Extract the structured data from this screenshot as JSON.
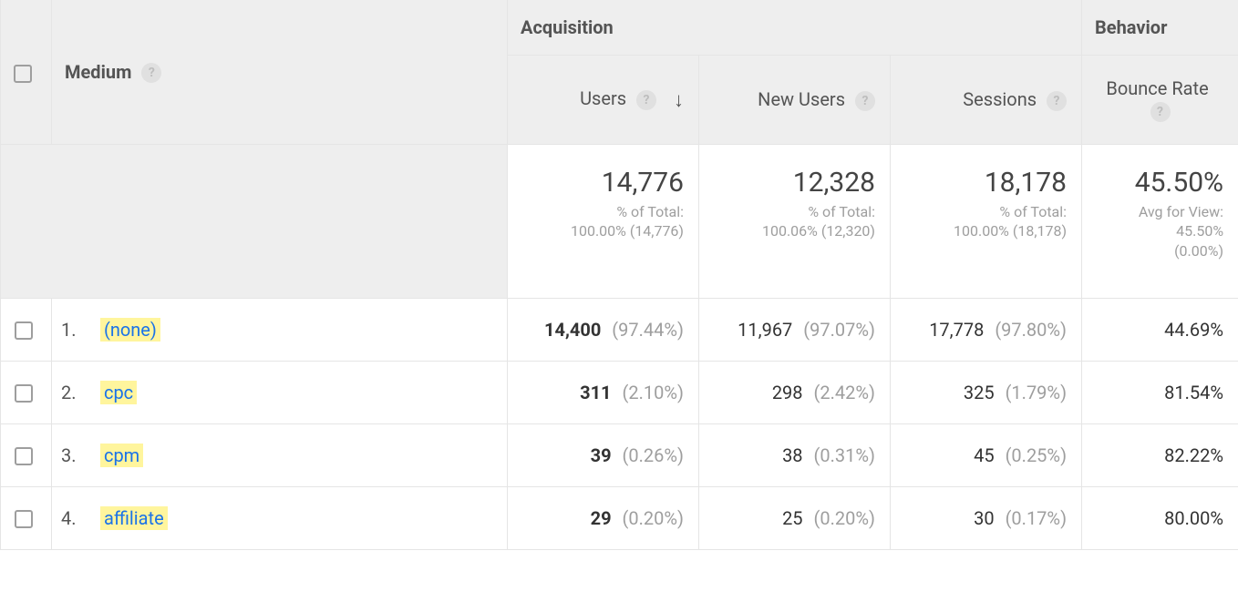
{
  "headers": {
    "dimension": "Medium",
    "group1": "Acquisition",
    "group2": "Behavior",
    "metrics": {
      "users": "Users",
      "new_users": "New Users",
      "sessions": "Sessions",
      "bounce_rate": "Bounce Rate"
    }
  },
  "totals": {
    "users": {
      "value": "14,776",
      "sub1": "% of Total:",
      "sub2": "100.00% (14,776)"
    },
    "new_users": {
      "value": "12,328",
      "sub1": "% of Total:",
      "sub2": "100.06% (12,320)"
    },
    "sessions": {
      "value": "18,178",
      "sub1": "% of Total:",
      "sub2": "100.00% (18,178)"
    },
    "bounce_rate": {
      "value": "45.50%",
      "sub1": "Avg for View:",
      "sub2": "45.50%",
      "sub3": "(0.00%)"
    }
  },
  "rows": [
    {
      "n": "1.",
      "medium": "(none)",
      "users_v": "14,400",
      "users_p": "(97.44%)",
      "new_v": "11,967",
      "new_p": "(97.07%)",
      "sess_v": "17,778",
      "sess_p": "(97.80%)",
      "bounce": "44.69%"
    },
    {
      "n": "2.",
      "medium": "cpc",
      "users_v": "311",
      "users_p": "(2.10%)",
      "new_v": "298",
      "new_p": "(2.42%)",
      "sess_v": "325",
      "sess_p": "(1.79%)",
      "bounce": "81.54%"
    },
    {
      "n": "3.",
      "medium": "cpm",
      "users_v": "39",
      "users_p": "(0.26%)",
      "new_v": "38",
      "new_p": "(0.31%)",
      "sess_v": "45",
      "sess_p": "(0.25%)",
      "bounce": "82.22%"
    },
    {
      "n": "4.",
      "medium": "affiliate",
      "users_v": "29",
      "users_p": "(0.20%)",
      "new_v": "25",
      "new_p": "(0.20%)",
      "sess_v": "30",
      "sess_p": "(0.17%)",
      "bounce": "80.00%"
    }
  ]
}
